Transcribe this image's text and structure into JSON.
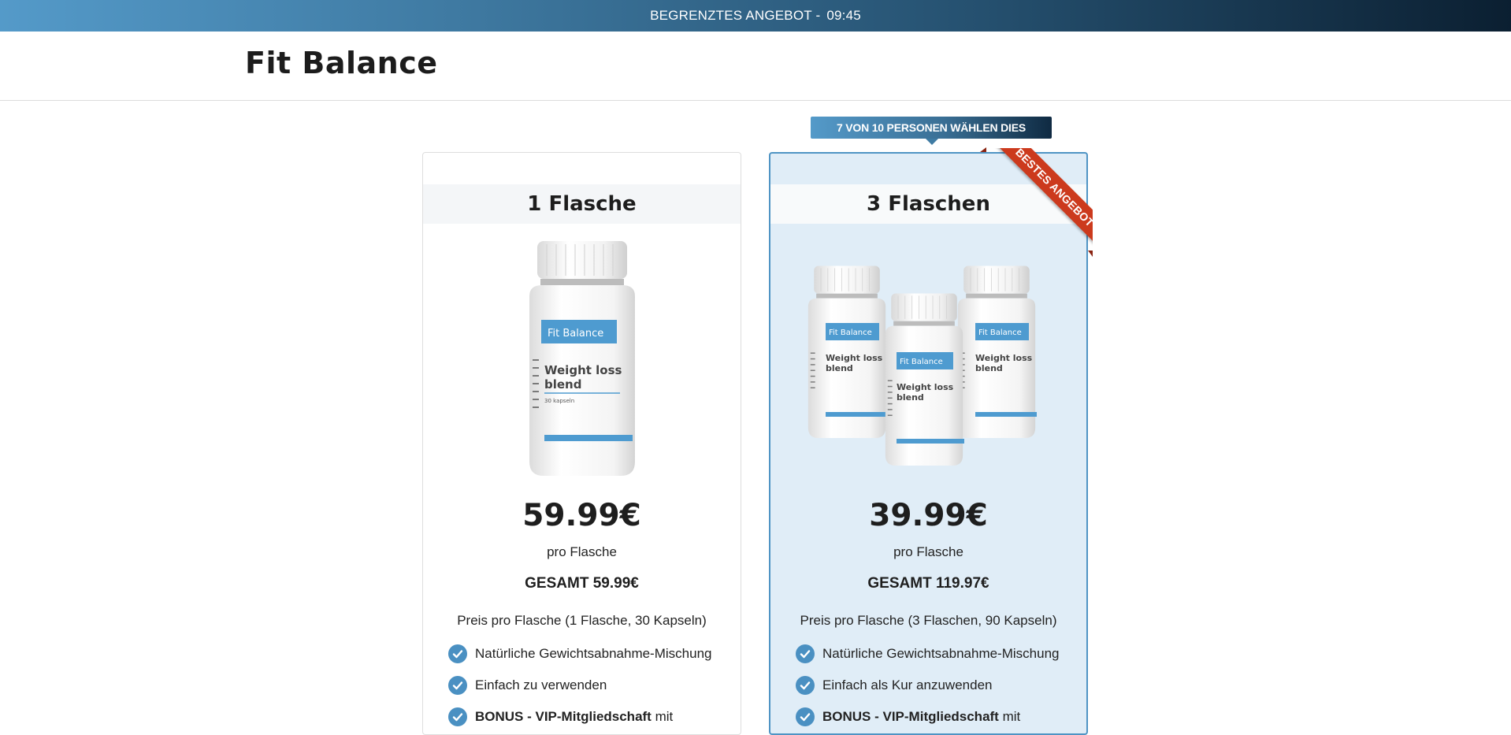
{
  "topbar": {
    "label": "BEGRENZTES ANGEBOT -",
    "timer": "09:45"
  },
  "header": {
    "logo": "Fit Balance"
  },
  "popular_badge": "7 VON 10 PERSONEN WÄHLEN DIES",
  "ribbon": "BESTES ANGEBOT",
  "bottle": {
    "brand": "Fit Balance",
    "name_line1": "Weight loss",
    "name_line2": "blend",
    "capsules": "30 kapseln"
  },
  "cards": [
    {
      "title": "1 Flasche",
      "price": "59.99€",
      "per": "pro Flasche",
      "total": "GESAMT 59.99€",
      "detail": "Preis pro Flasche (1 Flasche, 30 Kapseln)",
      "features": [
        "Natürliche Gewichtsabnahme-Mischung",
        "Einfach zu verwenden"
      ],
      "bonus_bold": "BONUS - VIP-Mitgliedschaft",
      "bonus_rest": " mit"
    },
    {
      "title": "3 Flaschen",
      "price": "39.99€",
      "per": "pro Flasche",
      "total": "GESAMT 119.97€",
      "detail": "Preis pro Flasche (3 Flaschen, 90 Kapseln)",
      "features": [
        "Natürliche Gewichtsabnahme-Mischung",
        "Einfach als Kur anzuwenden"
      ],
      "bonus_bold": "BONUS - VIP-Mitgliedschaft",
      "bonus_rest": " mit"
    }
  ],
  "colors": {
    "accent": "#4a90c2",
    "ribbon": "#cc3a1d",
    "highlight_card": "#e0edf7"
  }
}
